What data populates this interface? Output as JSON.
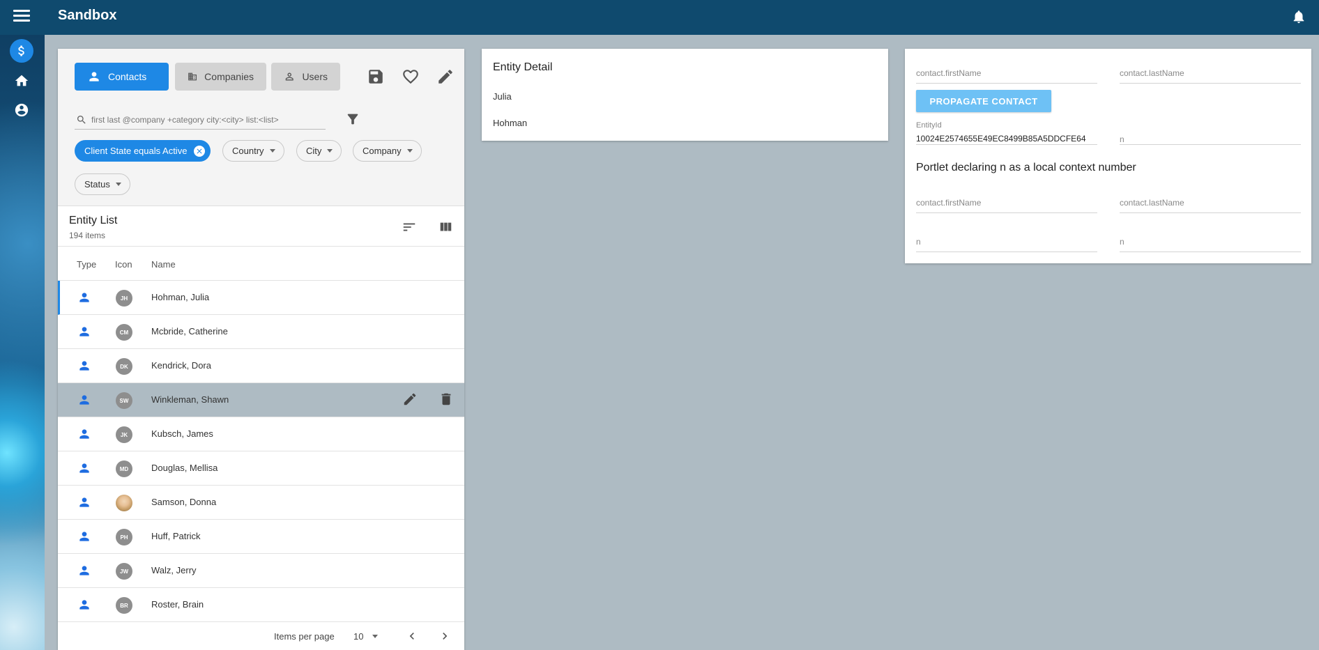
{
  "app": {
    "title": "Sandbox"
  },
  "toolbar": {
    "tabs": [
      {
        "label": "Contacts",
        "active": true
      },
      {
        "label": "Companies",
        "active": false
      },
      {
        "label": "Users",
        "active": false
      }
    ]
  },
  "search": {
    "placeholder": "first last @company +category city:<city> list:<list>"
  },
  "filters": {
    "active_chip": "Client State equals Active",
    "chips": [
      "Country",
      "City",
      "Company",
      "Status"
    ]
  },
  "entity_list": {
    "title": "Entity List",
    "count": "194 items",
    "columns": [
      "Type",
      "Icon",
      "Name"
    ],
    "rows": [
      {
        "initials": "JH",
        "name": "Hohman, Julia",
        "selected": true
      },
      {
        "initials": "CM",
        "name": "Mcbride, Catherine"
      },
      {
        "initials": "DK",
        "name": "Kendrick, Dora"
      },
      {
        "initials": "SW",
        "name": "Winkleman, Shawn",
        "hovered": true
      },
      {
        "initials": "JK",
        "name": "Kubsch, James"
      },
      {
        "initials": "MD",
        "name": "Douglas, Mellisa"
      },
      {
        "initials": "",
        "name": "Samson, Donna",
        "photo": true
      },
      {
        "initials": "PH",
        "name": "Huff, Patrick"
      },
      {
        "initials": "JW",
        "name": "Walz, Jerry"
      },
      {
        "initials": "BR",
        "name": "Roster, Brain"
      }
    ],
    "pager": {
      "items_per_page_label": "Items per page",
      "items_per_page": "10"
    }
  },
  "entity_detail": {
    "title": "Entity Detail",
    "first": "Julia",
    "last": "Hohman"
  },
  "right_panel": {
    "first_name_label": "contact.firstName",
    "last_name_label": "contact.lastName",
    "propagate_label": "PROPAGATE CONTACT",
    "entity_id_label": "EntityId",
    "entity_id_value": "10024E2574655E49EC8499B85A5DDCFE64",
    "n_label": "n",
    "portlet_title": "Portlet declaring n as a local context number",
    "portlet_first_name_label": "contact.firstName",
    "portlet_last_name_label": "contact.lastName",
    "portlet_n_label_1": "n",
    "portlet_n_label_2": "n"
  },
  "colors": {
    "topbar": "#0f4a6e",
    "accent": "#1e88e5",
    "button_light": "#6ec1f5",
    "background": "#aebbc3"
  }
}
